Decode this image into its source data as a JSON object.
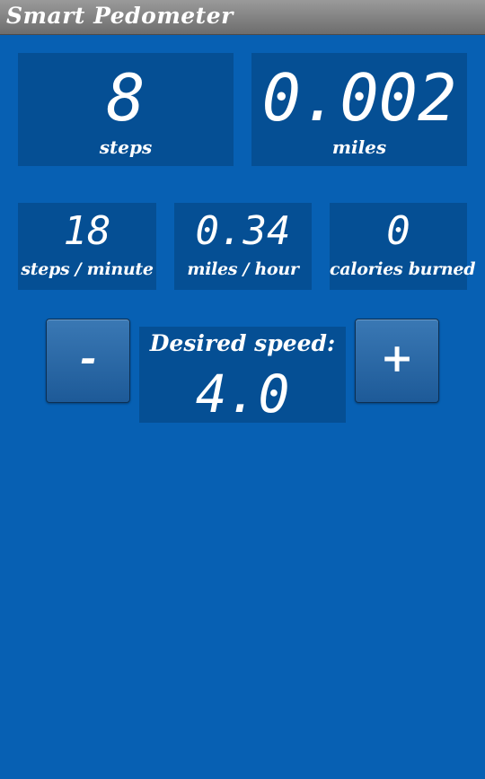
{
  "app": {
    "title": "Smart Pedometer"
  },
  "stats": {
    "steps": {
      "value": "8",
      "label": "steps"
    },
    "miles": {
      "value": "0.002",
      "label": "miles"
    },
    "steps_per_minute": {
      "value": "18",
      "label": "steps / minute"
    },
    "miles_per_hour": {
      "value": "0.34",
      "label": "miles / hour"
    },
    "calories": {
      "value": "0",
      "label": "calories burned"
    }
  },
  "speed_control": {
    "decrease_label": "-",
    "increase_label": "+",
    "desired_label": "Desired speed:",
    "desired_value": "4.0"
  },
  "colors": {
    "background": "#0760b3",
    "panel": "#054f94",
    "title_bar": "#7d7d7d",
    "text": "#ffffff"
  }
}
